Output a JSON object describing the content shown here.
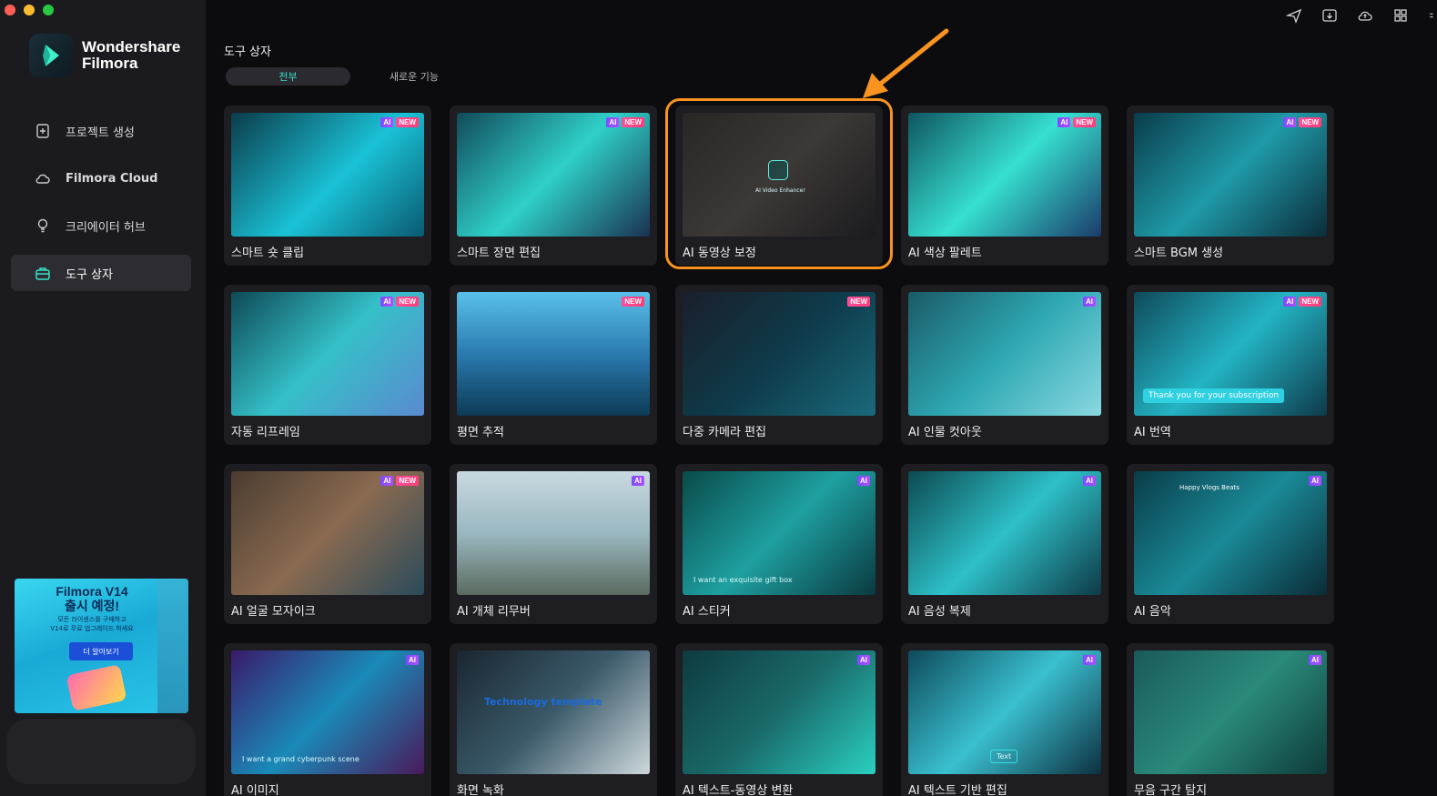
{
  "app": {
    "name_line1": "Wondershare",
    "name_line2": "Filmora",
    "traffic_colors": [
      "#ff5f57",
      "#febc2e",
      "#28c840"
    ]
  },
  "sidebar": {
    "items": [
      {
        "label": "프로젝트 생성",
        "icon": "new-project-icon",
        "active": false
      },
      {
        "label": "Filmora Cloud",
        "icon": "cloud-icon",
        "active": false
      },
      {
        "label": "크리에이터 허브",
        "icon": "lightbulb-icon",
        "active": false
      },
      {
        "label": "도구 상자",
        "icon": "toolbox-icon",
        "active": true
      }
    ],
    "promo": {
      "title_line1": "Filmora V14",
      "title_line2": "출시 예정!",
      "sub_line1": "모든 라이센스를 구매하고",
      "sub_line2": "V14로 무료 업그레이드 하세요",
      "button": "더 알아보기"
    }
  },
  "top_icons": [
    "send-icon",
    "media-download-icon",
    "cloud-upload-icon",
    "grid-apps-icon"
  ],
  "main": {
    "title": "도구 상자",
    "tabs": [
      {
        "label": "전부",
        "active": true
      },
      {
        "label": "새로운 기능",
        "active": false
      }
    ],
    "cards": [
      {
        "label": "스마트 숏 클립",
        "ai": true,
        "new": true
      },
      {
        "label": "스마트 장면 편집",
        "ai": true,
        "new": true
      },
      {
        "label": "AI 동영상 보정",
        "ai": false,
        "new": false,
        "thumb_text": "AI Video Enhancer"
      },
      {
        "label": "AI 색상 팔레트",
        "ai": true,
        "new": true
      },
      {
        "label": "스마트 BGM 생성",
        "ai": true,
        "new": true
      },
      {
        "label": "자동 리프레임",
        "ai": true,
        "new": true
      },
      {
        "label": "평면 추적",
        "ai": false,
        "new": true
      },
      {
        "label": "다중 카메라 편집",
        "ai": false,
        "new": true
      },
      {
        "label": "AI 인물 컷아웃",
        "ai": true,
        "new": false
      },
      {
        "label": "AI 번역",
        "ai": true,
        "new": true,
        "thumb_text": "Thank you for your subscription"
      },
      {
        "label": "AI 얼굴 모자이크",
        "ai": true,
        "new": true
      },
      {
        "label": "AI 개체 리무버",
        "ai": true,
        "new": false
      },
      {
        "label": "AI 스티커",
        "ai": true,
        "new": false,
        "thumb_text": "I want an exquisite gift box"
      },
      {
        "label": "AI 음성 복제",
        "ai": true,
        "new": false
      },
      {
        "label": "AI 음악",
        "ai": true,
        "new": false,
        "thumb_text": "Happy Vlogs Beats"
      },
      {
        "label": "AI 이미지",
        "ai": true,
        "new": false,
        "thumb_text": "I want a grand cyberpunk scene"
      },
      {
        "label": "화면 녹화",
        "ai": false,
        "new": false,
        "thumb_text": "Technology template"
      },
      {
        "label": "AI 텍스트-동영상 변환",
        "ai": true,
        "new": false
      },
      {
        "label": "AI 텍스트 기반 편집",
        "ai": true,
        "new": false,
        "thumb_text": "Text"
      },
      {
        "label": "무음 구간 탐지",
        "ai": true,
        "new": false
      }
    ],
    "badge_ai": "AI",
    "badge_new": "NEW",
    "accent": "#38e0c8",
    "highlight_color": "#f7931e"
  }
}
